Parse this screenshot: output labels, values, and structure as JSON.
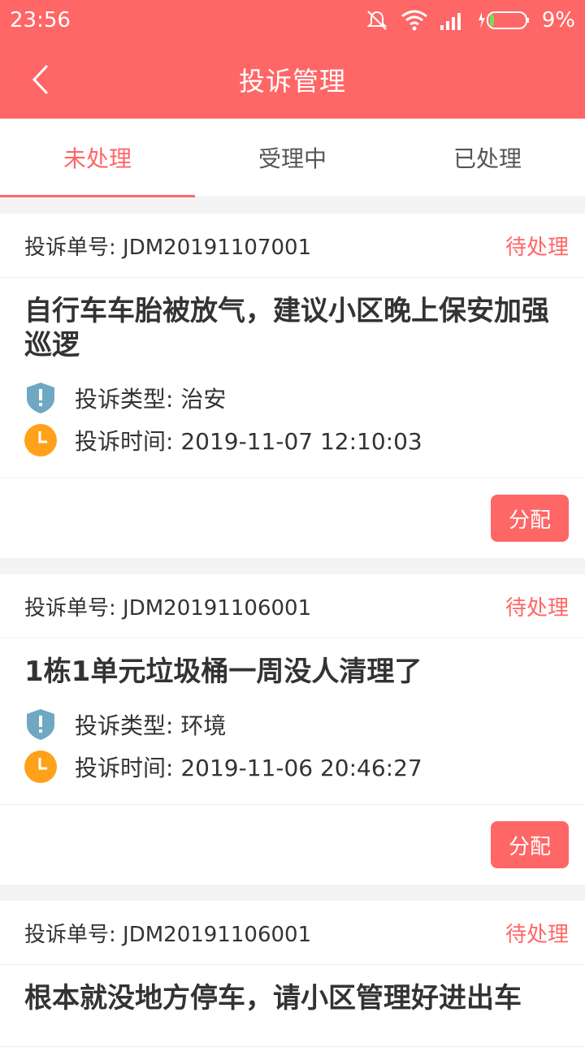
{
  "statusbar": {
    "time": "23:56",
    "battery_text": "9%"
  },
  "navbar": {
    "title": "投诉管理",
    "back_icon": "chevron-left-icon"
  },
  "tabs": [
    {
      "label": "未处理"
    },
    {
      "label": "受理中"
    },
    {
      "label": "已处理"
    }
  ],
  "complaints": [
    {
      "number_label": "投诉单号: ",
      "number": "JDM20191107001",
      "status": "待处理",
      "title": "自行车车胎被放气，建议小区晚上保安加强巡逻",
      "type_label": "投诉类型: ",
      "type": "治安",
      "time_label": "投诉时间: ",
      "time": "2019-11-07 12:10:03",
      "action": "分配"
    },
    {
      "number_label": "投诉单号: ",
      "number": "JDM20191106001",
      "status": "待处理",
      "title": "1栋1单元垃圾桶一周没人清理了",
      "type_label": "投诉类型: ",
      "type": "环境",
      "time_label": "投诉时间: ",
      "time": "2019-11-06 20:46:27",
      "action": "分配"
    },
    {
      "number_label": "投诉单号: ",
      "number": "JDM20191106001",
      "status": "待处理",
      "title": "根本就没地方停车，请小区管理好进出车"
    }
  ],
  "colors": {
    "accent": "#ff6666",
    "shield": "#6fa8c2",
    "clock": "#ffa21a"
  }
}
